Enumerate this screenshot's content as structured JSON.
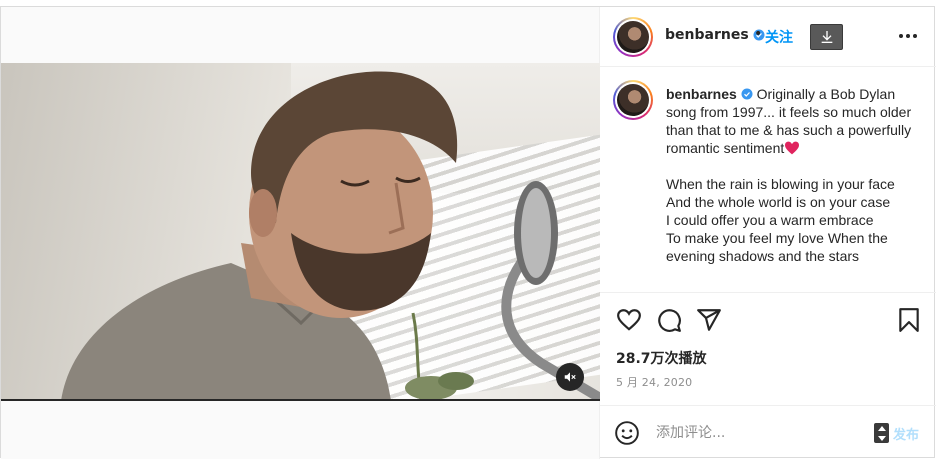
{
  "header": {
    "username": "benbarnes",
    "separator": "•",
    "follow_label": "关注"
  },
  "caption": {
    "username": "benbarnes",
    "line1": "Originally a Bob Dylan song from 1997... it feels so much older than that to me & has such a powerfully romantic sentiment",
    "lyric1": "When the rain is blowing in your face",
    "lyric2": "And the whole world is on your case",
    "lyric3": "I could offer you a warm embrace",
    "lyric4": "To make you feel my love When the",
    "lyric5": "evening shadows and the stars"
  },
  "stats": {
    "views": "28.7万次播放",
    "date": "5 月 24, 2020"
  },
  "comment": {
    "placeholder": "添加评论...",
    "post_label": "发布"
  },
  "colors": {
    "accent": "#0095f6",
    "verified": "#3897f0",
    "post_disabled": "#b2dffc",
    "heart": "#e0245e"
  },
  "icons": {
    "like": "heart-outline-icon",
    "comment": "comment-bubble-icon",
    "share": "paper-plane-icon",
    "save": "bookmark-icon",
    "mute": "speaker-muted-icon",
    "more": "more-horizontal-icon",
    "download": "download-icon",
    "emoji": "smiley-icon"
  }
}
